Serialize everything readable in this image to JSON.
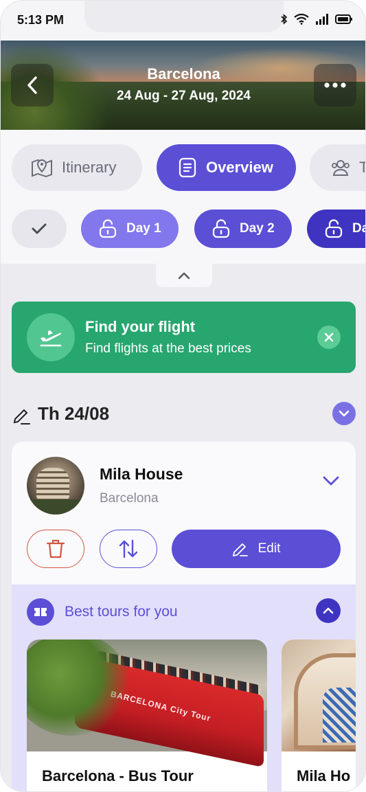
{
  "status": {
    "time": "5:13 PM"
  },
  "trip": {
    "title": "Barcelona",
    "dates": "24 Aug -  27 Aug, 2024"
  },
  "tabs": [
    {
      "label": "Itinerary",
      "icon": "map-pin-icon",
      "active": false
    },
    {
      "label": "Overview",
      "icon": "document-icon",
      "active": true
    },
    {
      "label": "T",
      "icon": "people-icon",
      "active": false
    }
  ],
  "days": [
    {
      "label": "Day 1",
      "color": "#8277ec"
    },
    {
      "label": "Day 2",
      "color": "#5b4fd6"
    },
    {
      "label": "Da",
      "color": "#3f34c1"
    }
  ],
  "flight_banner": {
    "title": "Find your flight",
    "subtitle": "Find flights at the best prices",
    "color": "#27a66f"
  },
  "day_header": {
    "label": "Th 24/08"
  },
  "place": {
    "name": "Mila House",
    "city": "Barcelona"
  },
  "actions": {
    "edit_label": "Edit"
  },
  "tours": {
    "title": "Best tours for you",
    "items": [
      {
        "name": "Barcelona - Bus Tour",
        "image_text": "BARCELONA City Tour"
      },
      {
        "name": "Mila Ho"
      }
    ]
  },
  "colors": {
    "accent": "#5b4fd6",
    "success": "#27a66f",
    "danger": "#d0563f"
  }
}
